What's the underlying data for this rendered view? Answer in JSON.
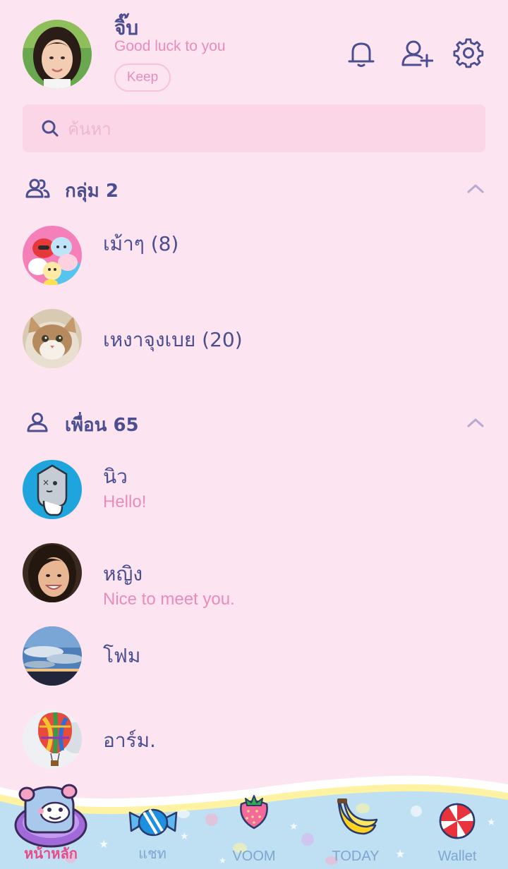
{
  "profile": {
    "name": "จิ๊บ",
    "status": "Good luck to you",
    "keep_label": "Keep"
  },
  "header_icons": [
    "bell-icon",
    "add-friend-icon",
    "gear-icon"
  ],
  "search": {
    "placeholder": "ค้นหา"
  },
  "groups": {
    "title": "กลุ่ม 2",
    "items": [
      {
        "name": "เม้าๆ (8)",
        "avatar": "bt21-characters"
      },
      {
        "name": "เหงาจุงเบย (20)",
        "avatar": "cat-photo"
      }
    ]
  },
  "friends": {
    "title": "เพื่อน 65",
    "items": [
      {
        "name": "นิว",
        "message": "Hello!",
        "avatar": "cartoon-character"
      },
      {
        "name": "หญิง",
        "message": "Nice to meet you.",
        "avatar": "woman-photo"
      },
      {
        "name": "โฟม",
        "message": "",
        "avatar": "sky-photo"
      },
      {
        "name": "อาร์ม.",
        "message": "",
        "avatar": "hot-air-balloon-photo"
      }
    ]
  },
  "nav": {
    "items": [
      {
        "label": "หน้าหลัก",
        "icon": "home-character-icon",
        "active": true
      },
      {
        "label": "แชท",
        "icon": "candy-icon",
        "active": false
      },
      {
        "label": "VOOM",
        "icon": "strawberry-icon",
        "active": false
      },
      {
        "label": "TODAY",
        "icon": "banana-icon",
        "active": false
      },
      {
        "label": "Wallet",
        "icon": "peppermint-icon",
        "active": false
      }
    ]
  },
  "colors": {
    "background": "#fde4f1",
    "primary_text": "#4b4e8f",
    "accent_pink": "#e98cba",
    "active_nav": "#e94b8a",
    "nav_text": "#7fa6d0"
  }
}
